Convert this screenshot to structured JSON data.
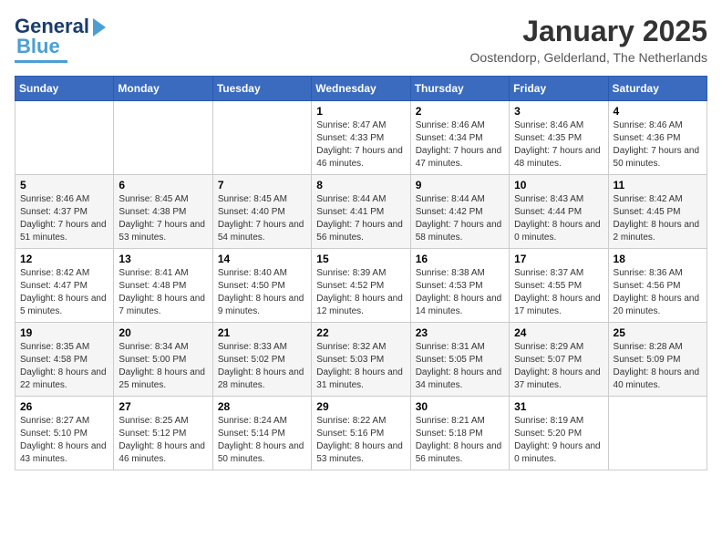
{
  "header": {
    "logo_general": "General",
    "logo_blue": "Blue",
    "month_title": "January 2025",
    "location": "Oostendorp, Gelderland, The Netherlands"
  },
  "weekdays": [
    "Sunday",
    "Monday",
    "Tuesday",
    "Wednesday",
    "Thursday",
    "Friday",
    "Saturday"
  ],
  "weeks": [
    [
      {
        "day": "",
        "info": ""
      },
      {
        "day": "",
        "info": ""
      },
      {
        "day": "",
        "info": ""
      },
      {
        "day": "1",
        "info": "Sunrise: 8:47 AM\nSunset: 4:33 PM\nDaylight: 7 hours and 46 minutes."
      },
      {
        "day": "2",
        "info": "Sunrise: 8:46 AM\nSunset: 4:34 PM\nDaylight: 7 hours and 47 minutes."
      },
      {
        "day": "3",
        "info": "Sunrise: 8:46 AM\nSunset: 4:35 PM\nDaylight: 7 hours and 48 minutes."
      },
      {
        "day": "4",
        "info": "Sunrise: 8:46 AM\nSunset: 4:36 PM\nDaylight: 7 hours and 50 minutes."
      }
    ],
    [
      {
        "day": "5",
        "info": "Sunrise: 8:46 AM\nSunset: 4:37 PM\nDaylight: 7 hours and 51 minutes."
      },
      {
        "day": "6",
        "info": "Sunrise: 8:45 AM\nSunset: 4:38 PM\nDaylight: 7 hours and 53 minutes."
      },
      {
        "day": "7",
        "info": "Sunrise: 8:45 AM\nSunset: 4:40 PM\nDaylight: 7 hours and 54 minutes."
      },
      {
        "day": "8",
        "info": "Sunrise: 8:44 AM\nSunset: 4:41 PM\nDaylight: 7 hours and 56 minutes."
      },
      {
        "day": "9",
        "info": "Sunrise: 8:44 AM\nSunset: 4:42 PM\nDaylight: 7 hours and 58 minutes."
      },
      {
        "day": "10",
        "info": "Sunrise: 8:43 AM\nSunset: 4:44 PM\nDaylight: 8 hours and 0 minutes."
      },
      {
        "day": "11",
        "info": "Sunrise: 8:42 AM\nSunset: 4:45 PM\nDaylight: 8 hours and 2 minutes."
      }
    ],
    [
      {
        "day": "12",
        "info": "Sunrise: 8:42 AM\nSunset: 4:47 PM\nDaylight: 8 hours and 5 minutes."
      },
      {
        "day": "13",
        "info": "Sunrise: 8:41 AM\nSunset: 4:48 PM\nDaylight: 8 hours and 7 minutes."
      },
      {
        "day": "14",
        "info": "Sunrise: 8:40 AM\nSunset: 4:50 PM\nDaylight: 8 hours and 9 minutes."
      },
      {
        "day": "15",
        "info": "Sunrise: 8:39 AM\nSunset: 4:52 PM\nDaylight: 8 hours and 12 minutes."
      },
      {
        "day": "16",
        "info": "Sunrise: 8:38 AM\nSunset: 4:53 PM\nDaylight: 8 hours and 14 minutes."
      },
      {
        "day": "17",
        "info": "Sunrise: 8:37 AM\nSunset: 4:55 PM\nDaylight: 8 hours and 17 minutes."
      },
      {
        "day": "18",
        "info": "Sunrise: 8:36 AM\nSunset: 4:56 PM\nDaylight: 8 hours and 20 minutes."
      }
    ],
    [
      {
        "day": "19",
        "info": "Sunrise: 8:35 AM\nSunset: 4:58 PM\nDaylight: 8 hours and 22 minutes."
      },
      {
        "day": "20",
        "info": "Sunrise: 8:34 AM\nSunset: 5:00 PM\nDaylight: 8 hours and 25 minutes."
      },
      {
        "day": "21",
        "info": "Sunrise: 8:33 AM\nSunset: 5:02 PM\nDaylight: 8 hours and 28 minutes."
      },
      {
        "day": "22",
        "info": "Sunrise: 8:32 AM\nSunset: 5:03 PM\nDaylight: 8 hours and 31 minutes."
      },
      {
        "day": "23",
        "info": "Sunrise: 8:31 AM\nSunset: 5:05 PM\nDaylight: 8 hours and 34 minutes."
      },
      {
        "day": "24",
        "info": "Sunrise: 8:29 AM\nSunset: 5:07 PM\nDaylight: 8 hours and 37 minutes."
      },
      {
        "day": "25",
        "info": "Sunrise: 8:28 AM\nSunset: 5:09 PM\nDaylight: 8 hours and 40 minutes."
      }
    ],
    [
      {
        "day": "26",
        "info": "Sunrise: 8:27 AM\nSunset: 5:10 PM\nDaylight: 8 hours and 43 minutes."
      },
      {
        "day": "27",
        "info": "Sunrise: 8:25 AM\nSunset: 5:12 PM\nDaylight: 8 hours and 46 minutes."
      },
      {
        "day": "28",
        "info": "Sunrise: 8:24 AM\nSunset: 5:14 PM\nDaylight: 8 hours and 50 minutes."
      },
      {
        "day": "29",
        "info": "Sunrise: 8:22 AM\nSunset: 5:16 PM\nDaylight: 8 hours and 53 minutes."
      },
      {
        "day": "30",
        "info": "Sunrise: 8:21 AM\nSunset: 5:18 PM\nDaylight: 8 hours and 56 minutes."
      },
      {
        "day": "31",
        "info": "Sunrise: 8:19 AM\nSunset: 5:20 PM\nDaylight: 9 hours and 0 minutes."
      },
      {
        "day": "",
        "info": ""
      }
    ]
  ]
}
